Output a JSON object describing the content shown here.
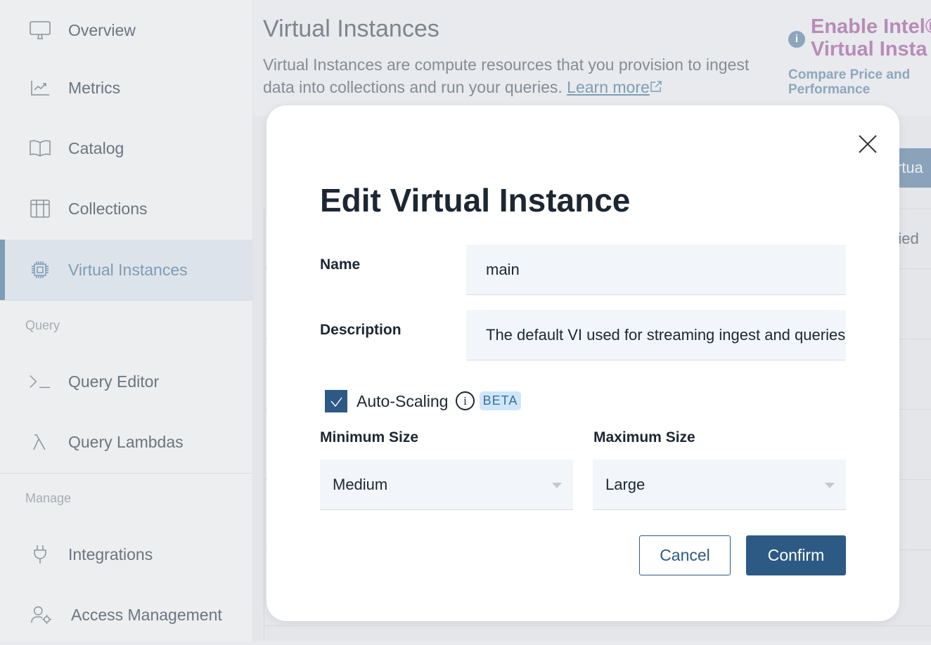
{
  "sidebar": {
    "items": [
      {
        "label": "Overview",
        "icon": "monitor-icon"
      },
      {
        "label": "Metrics",
        "icon": "chart-icon"
      },
      {
        "label": "Catalog",
        "icon": "book-icon"
      },
      {
        "label": "Collections",
        "icon": "table-icon"
      },
      {
        "label": "Virtual Instances",
        "icon": "chip-icon",
        "active": true
      }
    ],
    "query_section": "Query",
    "query_items": [
      {
        "label": "Query Editor",
        "icon": "terminal-icon"
      },
      {
        "label": "Query Lambdas",
        "icon": "lambda-icon"
      }
    ],
    "manage_section": "Manage",
    "manage_items": [
      {
        "label": "Integrations",
        "icon": "plug-icon"
      },
      {
        "label": "Access Management",
        "icon": "user-gear-icon"
      }
    ]
  },
  "page": {
    "title": "Virtual Instances",
    "description": "Virtual Instances are compute resources that you provision to ingest data into collections and run your queries.",
    "learn_more": "Learn more",
    "promo_title_1": "Enable Intel®",
    "promo_title_2": "Virtual Insta",
    "promo_link": "Compare Price and Performance",
    "bg_button": "irtua",
    "bg_header": "ried"
  },
  "modal": {
    "title": "Edit Virtual Instance",
    "name_label": "Name",
    "name_value": "main",
    "description_label": "Description",
    "description_value": "The default VI used for streaming ingest and queries",
    "autoscaling_label": "Auto-Scaling",
    "autoscaling_checked": true,
    "beta_badge": "BETA",
    "min_label": "Minimum Size",
    "min_value": "Medium",
    "max_label": "Maximum Size",
    "max_value": "Large",
    "cancel": "Cancel",
    "confirm": "Confirm"
  },
  "colors": {
    "accent": "#2c5a85",
    "promo": "#b88bb8",
    "active_nav": "#7f9cb6"
  }
}
